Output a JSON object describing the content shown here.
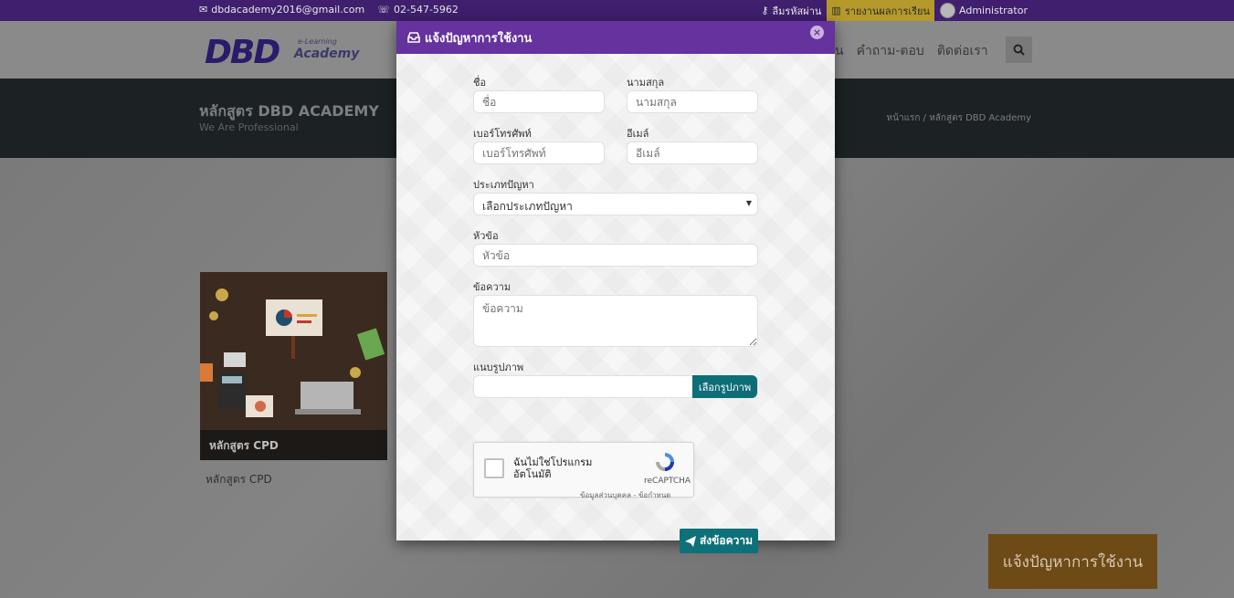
{
  "topbar": {
    "email": "dbdacademy2016@gmail.com",
    "phone": "02-547-5962",
    "forgot_password": "ลืมรหัสผ่าน",
    "report": "รายงานผลการเรียน",
    "user": "Administrator"
  },
  "header": {
    "logo_text": "DBD",
    "logo_sub1": "e-Learning",
    "logo_sub2": "Academy",
    "nav": [
      "น",
      "คำถาม-ตอบ",
      "ติดต่อเรา"
    ]
  },
  "banner": {
    "title": "หลักสูตร DBD ACADEMY",
    "tagline": "We Are Professional",
    "breadcrumb": "หน้าแรก / หลักสูตร DBD Academy"
  },
  "course": {
    "caption": "หลักสูตร CPD",
    "title": "หลักสูตร CPD"
  },
  "help_button": "แจ้งปัญหาการใช้งาน",
  "modal": {
    "title": "แจ้งปัญหาการใช้งาน",
    "close": "×",
    "fields": {
      "first_name": {
        "label": "ชื่อ",
        "placeholder": "ชื่อ"
      },
      "last_name": {
        "label": "นามสกุล",
        "placeholder": "นามสกุล"
      },
      "phone": {
        "label": "เบอร์โทรศัพท์",
        "placeholder": "เบอร์โทรศัพท์"
      },
      "email": {
        "label": "อีเมล์",
        "placeholder": "อีเมล์"
      },
      "problem_type": {
        "label": "ประเภทปัญหา",
        "value": "เลือกประเภทปัญหา"
      },
      "subject": {
        "label": "หัวข้อ",
        "placeholder": "หัวข้อ"
      },
      "message": {
        "label": "ข้อความ",
        "placeholder": "ข้อความ"
      },
      "image": {
        "label": "แนบรูปภาพ",
        "button": "เลือกรูปภาพ"
      }
    },
    "captcha": {
      "text": "ฉันไม่ใช่โปรแกรมอัตโนมัติ",
      "brand": "reCAPTCHA",
      "links": "ข้อมูลส่วนบุคคล - ข้อกำหนด"
    },
    "submit": "ส่งข้อความ"
  },
  "colors": {
    "modal_header": "#65329e",
    "button": "#0e7079",
    "topbar": "#3f1f6e"
  }
}
